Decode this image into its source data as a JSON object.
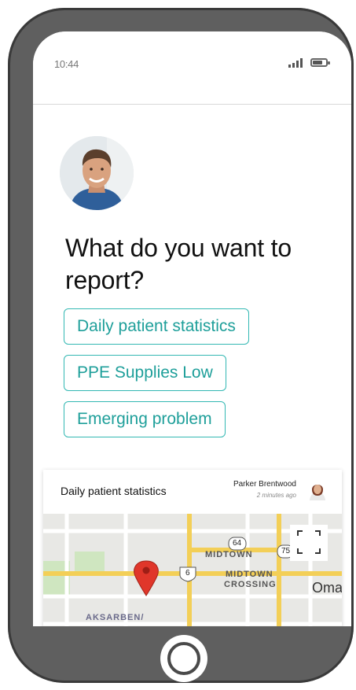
{
  "status": {
    "time": "10:44"
  },
  "prompt": {
    "question": "What do you want to report?"
  },
  "options": [
    {
      "label": "Daily patient statistics"
    },
    {
      "label": "PPE Supplies Low"
    },
    {
      "label": "Emerging problem"
    }
  ],
  "card": {
    "title": "Daily patient statistics",
    "user": "Parker Brentwood",
    "time": "2 minutes ago"
  },
  "map": {
    "labels": {
      "midtown": "MIDTOWN",
      "midtown_crossing_1": "MIDTOWN",
      "midtown_crossing_2": "CROSSING",
      "aksarben": "AKSARBEN/",
      "omaha": "Oma",
      "shield_64": "64",
      "shield_75": "75",
      "shield_6": "6"
    },
    "colors": {
      "road_major": "#f3cf57",
      "road_minor": "#ffffff",
      "park": "#cfe6c0",
      "pin": "#e0362a"
    }
  },
  "colors": {
    "accent": "#33b8b3",
    "phone_frame": "#5f5f5f"
  }
}
